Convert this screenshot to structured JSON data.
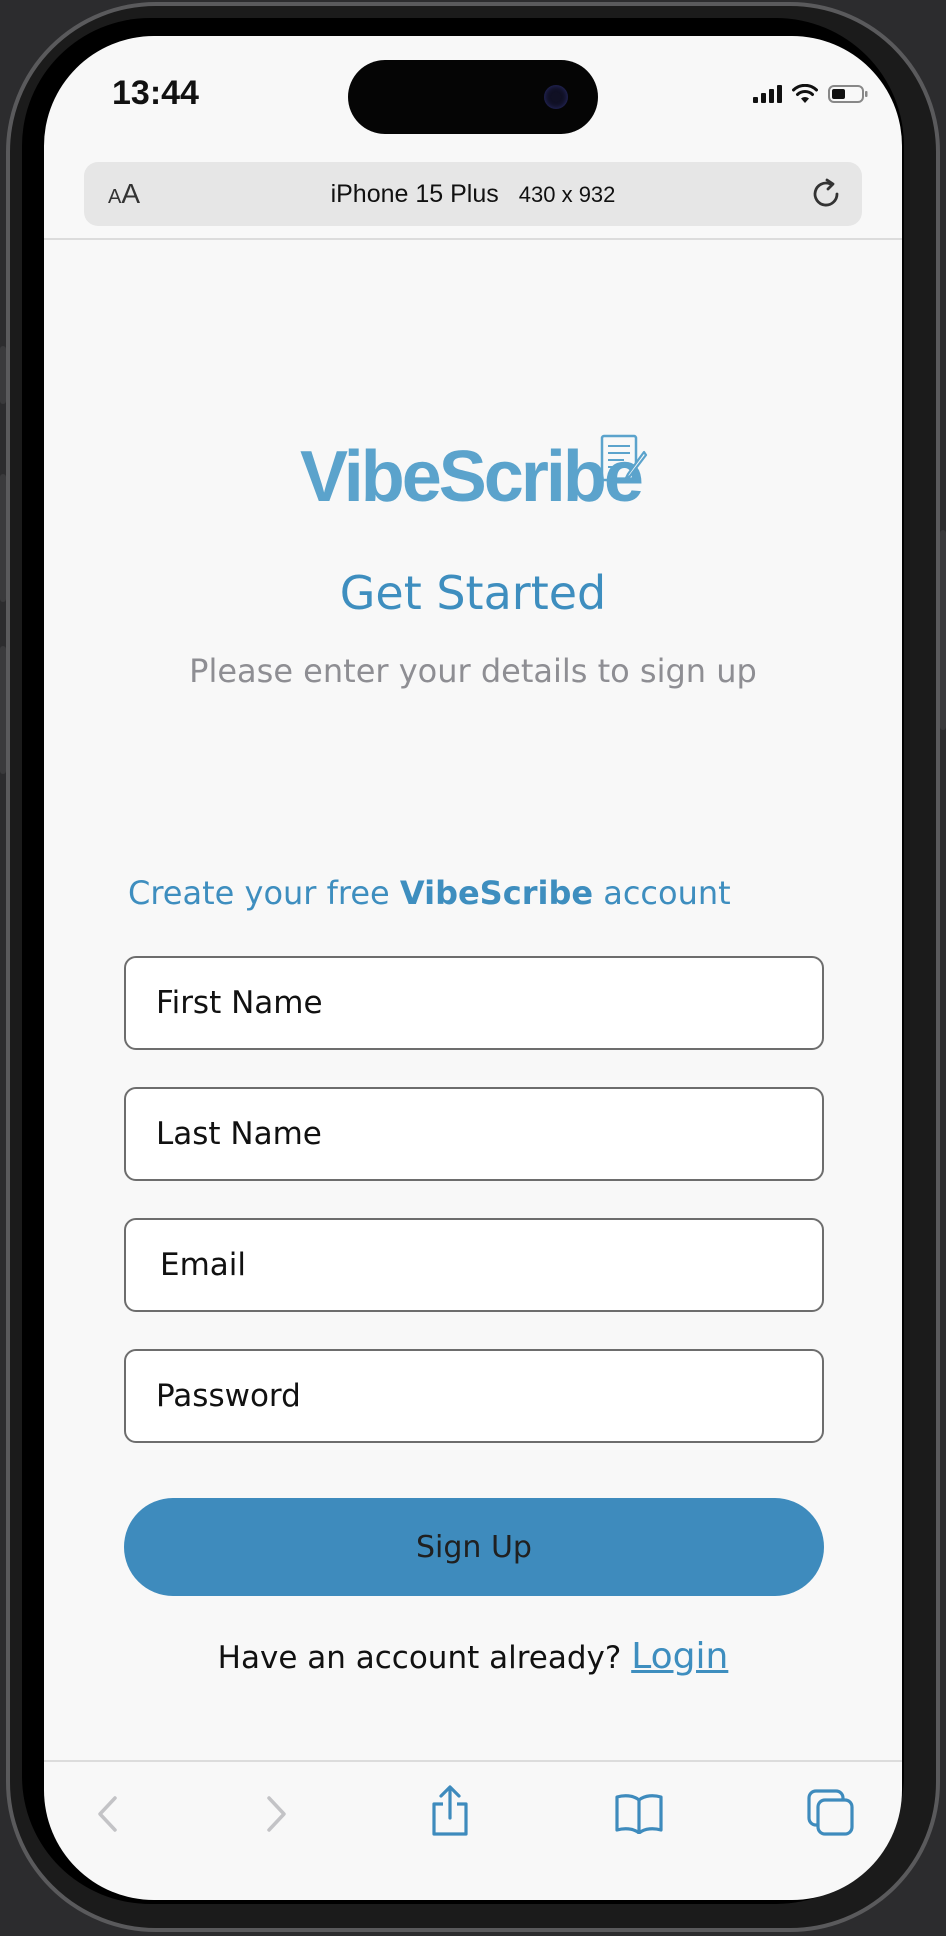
{
  "status_bar": {
    "time": "13:44"
  },
  "address_bar": {
    "text_size_small": "A",
    "text_size_big": "A",
    "device_name": "iPhone 15 Plus",
    "device_dims": "430 x 932"
  },
  "brand": {
    "logo_text": "VibeScribe",
    "color": "#5ba3cc"
  },
  "signup": {
    "title": "Get Started",
    "subtitle": "Please enter your details to sign up",
    "create_prefix": "Create your free ",
    "create_brand": "VibeScribe",
    "create_suffix": " account",
    "first_name_placeholder": "First Name",
    "last_name_placeholder": "Last Name",
    "email_placeholder": "Email",
    "password_placeholder": "Password",
    "button_label": "Sign Up",
    "login_prompt": "Have an account already? ",
    "login_link": "Login",
    "accent_color": "#3e8bbd"
  },
  "toolbar": {
    "icons": [
      "back-icon",
      "forward-icon",
      "share-icon",
      "bookmarks-icon",
      "tabs-icon"
    ]
  }
}
